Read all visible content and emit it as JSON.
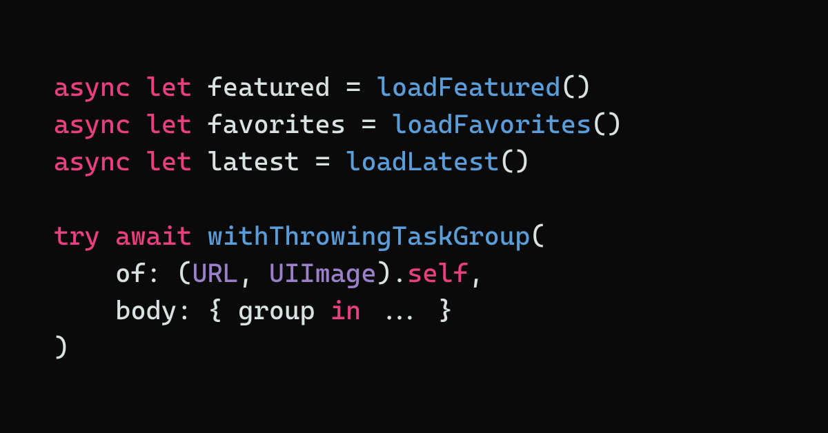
{
  "code": {
    "line1": {
      "kw_async": "async",
      "kw_let": "let",
      "var": "featured",
      "eq": "=",
      "fn": "loadFeatured",
      "parens": "()"
    },
    "line2": {
      "kw_async": "async",
      "kw_let": "let",
      "var": "favorites",
      "eq": "=",
      "fn": "loadFavorites",
      "parens": "()"
    },
    "line3": {
      "kw_async": "async",
      "kw_let": "let",
      "var": "latest",
      "eq": "=",
      "fn": "loadLatest",
      "parens": "()"
    },
    "line5": {
      "kw_try": "try",
      "kw_await": "await",
      "fn": "withThrowingTaskGroup",
      "open": "("
    },
    "line6": {
      "indent": "    ",
      "label": "of:",
      "space": " ",
      "open": "(",
      "type1": "URL",
      "comma": ", ",
      "type2": "UIImage",
      "close": ").",
      "self": "self",
      "trail": ","
    },
    "line7": {
      "indent": "    ",
      "label": "body:",
      "space": " ",
      "open": "{ ",
      "param": "group ",
      "kw_in": "in",
      "dots": " ... ",
      "close": "}"
    },
    "line8": {
      "close": ")"
    }
  }
}
